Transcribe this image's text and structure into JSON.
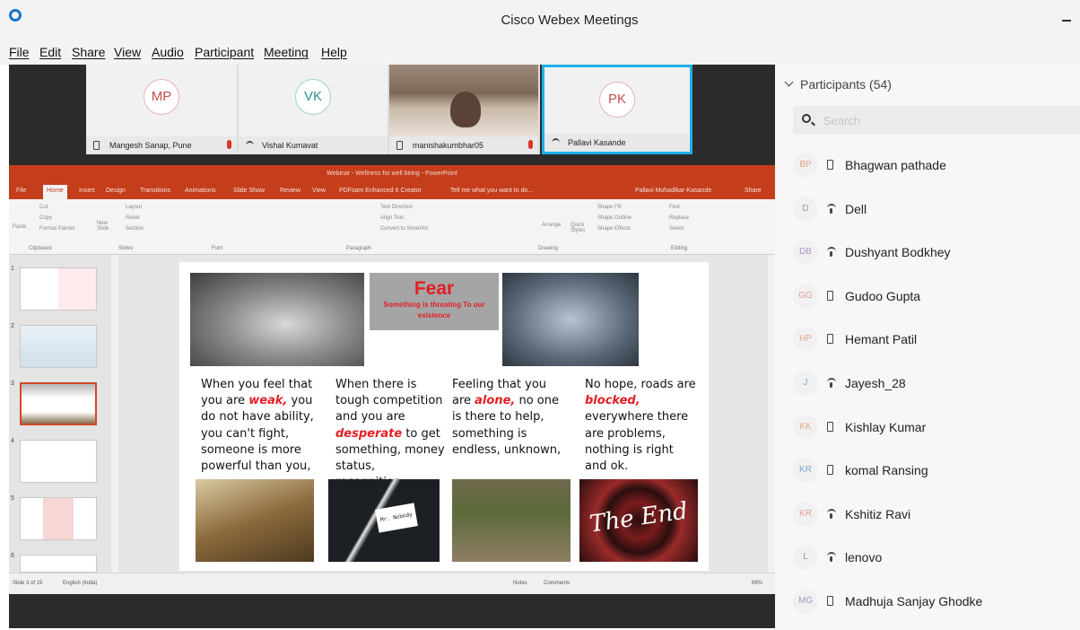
{
  "window": {
    "title": "Cisco Webex Meetings"
  },
  "menu": [
    "File",
    "Edit",
    "Share",
    "View",
    "Audio",
    "Participant",
    "Meeting",
    "Help"
  ],
  "video_tiles": [
    {
      "initials": "MP",
      "name": "Mangesh Sanap, Pune"
    },
    {
      "initials": "VK",
      "name": "Vishal Kumavat"
    },
    {
      "initials": "",
      "name": "manishakumbhar05"
    },
    {
      "initials": "PK",
      "name": "Pallavi Kasande"
    }
  ],
  "powerpoint": {
    "title": "Webinar - Wellness for well being - PowerPoint",
    "tabs": [
      "File",
      "Home",
      "Insert",
      "Design",
      "Transitions",
      "Animations",
      "Slide Show",
      "Review",
      "View",
      "PDFsam Enhanced 6 Creator"
    ],
    "tell_me": "Tell me what you want to do...",
    "user": "Pallavi Mohadikar-Kasande",
    "share": "Share",
    "ribbon_groups": [
      "Clipboard",
      "Slides",
      "Font",
      "Paragraph",
      "Drawing",
      "Editing"
    ],
    "ribbon_buttons": {
      "paste": "Paste",
      "cut": "Cut",
      "copy": "Copy",
      "format_painter": "Format Painter",
      "new_slide": "New Slide",
      "layout": "Layout",
      "reset": "Reset",
      "section": "Section",
      "text_direction": "Text Direction",
      "align_text": "Align Text",
      "convert_smartart": "Convert to SmartArt",
      "arrange": "Arrange",
      "quick_styles": "Quick Styles",
      "shape_fill": "Shape Fill",
      "shape_outline": "Shape Outline",
      "shape_effects": "Shape Effects",
      "find": "Find",
      "replace": "Replace",
      "select": "Select"
    },
    "thumb_numbers": [
      "1",
      "2",
      "3",
      "4",
      "5",
      "6"
    ],
    "status_left": "Slide 3 of 15",
    "status_lang": "English (India)",
    "status_notes": "Notes",
    "status_comments": "Comments",
    "status_zoom": "69%"
  },
  "slide": {
    "heading": "Fear",
    "subheading": "Something is threating To our existence",
    "columns": [
      {
        "pre": "When you feel that you are ",
        "em": "weak,",
        "post": " you do not have ability, you can't fight, someone is more powerful than you,"
      },
      {
        "pre": "When there is tough competition and you are ",
        "em": "desperate",
        "post": " to get something, money status, recognition,"
      },
      {
        "pre": "Feeling that you are ",
        "em": "alone,",
        "post": " no one is there to help, something is endless, unknown,"
      },
      {
        "pre": "No hope, roads are ",
        "em": "blocked,",
        "post": " everywhere there are problems, nothing is right and ok."
      }
    ],
    "tag_text": "Mr. Nobody",
    "end_text": "The End"
  },
  "participants": {
    "header": "Participants (54)",
    "search_placeholder": "Search",
    "list": [
      {
        "initials": "BP",
        "name": "Bhagwan pathade",
        "device": "phone",
        "color": "#e0a78b"
      },
      {
        "initials": "D",
        "name": "Dell",
        "device": "wifi",
        "color": "#999999"
      },
      {
        "initials": "DB",
        "name": "Dushyant Bodkhey",
        "device": "wifi",
        "color": "#a894c5"
      },
      {
        "initials": "GG",
        "name": "Gudoo Gupta",
        "device": "phone",
        "color": "#e59b9b"
      },
      {
        "initials": "HP",
        "name": "Hemant Patil",
        "device": "phone",
        "color": "#e0a78b"
      },
      {
        "initials": "J",
        "name": "Jayesh_28",
        "device": "wifi",
        "color": "#7aa8d0"
      },
      {
        "initials": "KK",
        "name": "Kishlay Kumar",
        "device": "phone",
        "color": "#e0a78b"
      },
      {
        "initials": "KR",
        "name": "komal Ransing",
        "device": "phone",
        "color": "#7aa8d0"
      },
      {
        "initials": "KR",
        "name": "Kshitiz Ravi",
        "device": "wifi",
        "color": "#e59b9b"
      },
      {
        "initials": "L",
        "name": "lenovo",
        "device": "wifi",
        "color": "#999999"
      },
      {
        "initials": "MG",
        "name": "Madhuja Sanjay Ghodke",
        "device": "phone",
        "color": "#a894c5"
      }
    ]
  }
}
